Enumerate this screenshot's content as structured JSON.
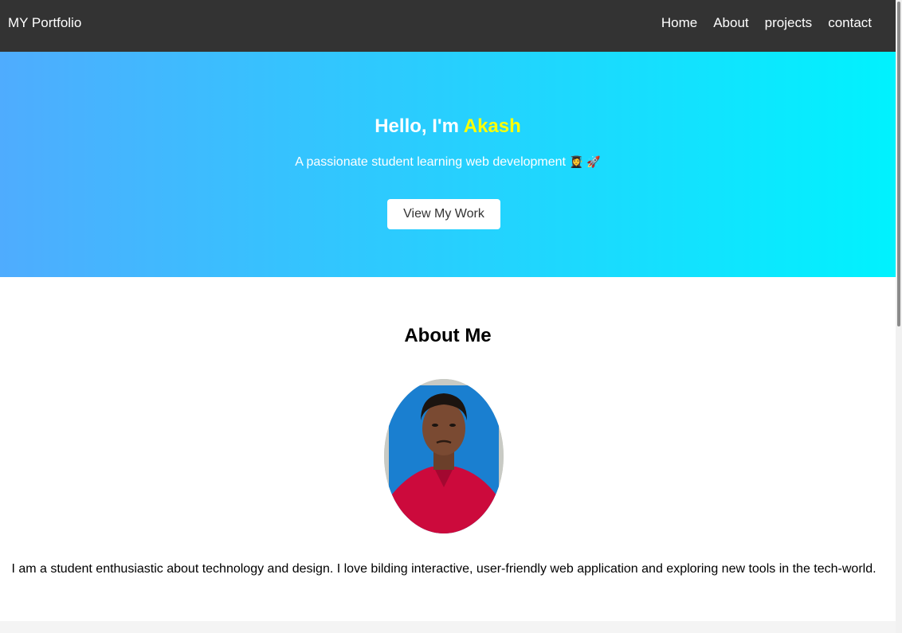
{
  "navbar": {
    "brand": "MY Portfolio",
    "links": [
      "Home",
      "About",
      "projects",
      "contact"
    ]
  },
  "hero": {
    "greeting": "Hello, I'm",
    "name": "Akash",
    "subtitle": "A passionate student learning web development",
    "emoji_1": "👩‍🎓",
    "emoji_2": "🚀",
    "button_label": "View My Work"
  },
  "about": {
    "title": "About Me",
    "description": "I am a student enthusiastic about technology and design. I love bilding interactive, user-friendly web application and exploring new tools in the tech-world."
  },
  "colors": {
    "navbar_bg": "#333333",
    "hero_gradient_start": "#4facfe",
    "hero_gradient_end": "#00f2fe",
    "name_highlight": "#ffff00"
  }
}
